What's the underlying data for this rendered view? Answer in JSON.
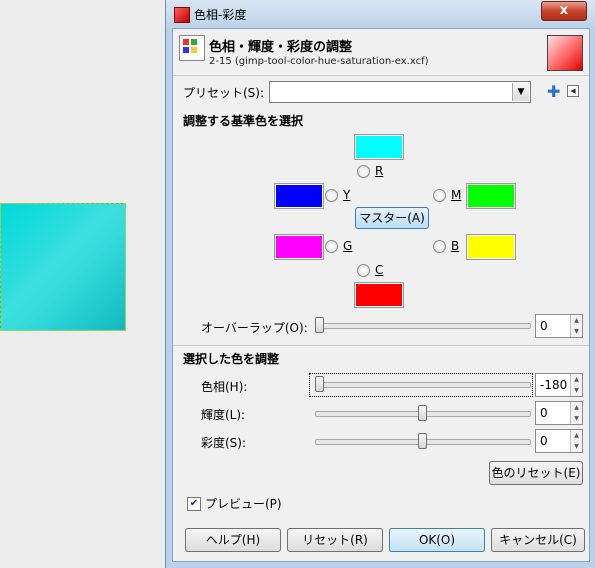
{
  "window": {
    "title": "色相-彩度",
    "close_glyph": "x"
  },
  "header": {
    "title": "色相・輝度・彩度の調整",
    "subtitle": "2-15 (gimp-tool-color-hue-saturation-ex.xcf)",
    "icon": "hue-saturation-tool-icon"
  },
  "preset": {
    "label": "プリセット(S):",
    "value": "",
    "add_icon": "plus-icon",
    "menu_icon": "panel-menu-icon"
  },
  "primary_select": {
    "heading": "調整する基準色を選択",
    "channels": [
      {
        "id": "R",
        "label": "R",
        "color": "#00ffff"
      },
      {
        "id": "Y",
        "label": "Y",
        "color": "#0000ff"
      },
      {
        "id": "M",
        "label": "M",
        "color": "#00ff00"
      },
      {
        "id": "G",
        "label": "G",
        "color": "#ff00ff"
      },
      {
        "id": "B",
        "label": "B",
        "color": "#ffff00"
      },
      {
        "id": "C",
        "label": "C",
        "color": "#ff0000"
      }
    ],
    "master_label": "マスター(A)",
    "overlap_label": "オーバーラップ(O):",
    "overlap_value": "0"
  },
  "adjust": {
    "heading": "選択した色を調整",
    "hue_label": "色相(H):",
    "hue_value": "-180",
    "lightness_label": "輝度(L):",
    "lightness_value": "0",
    "saturation_label": "彩度(S):",
    "saturation_value": "0",
    "reset_color_label": "色のリセット(E)"
  },
  "preview": {
    "label": "プレビュー(P)",
    "checked": true
  },
  "buttons": {
    "help": "ヘルプ(H)",
    "reset": "リセット(R)",
    "ok": "OK(O)",
    "cancel": "キャンセル(C)"
  }
}
